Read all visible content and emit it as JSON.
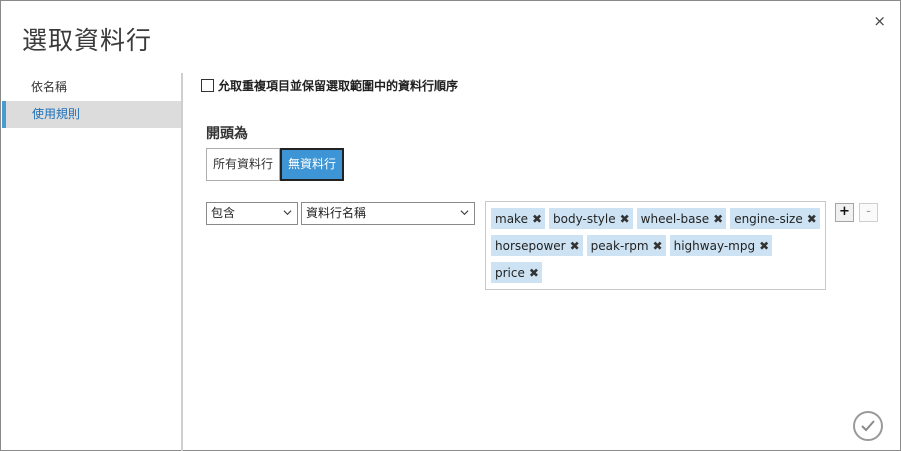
{
  "dialog": {
    "title": "選取資料行",
    "close_glyph": "×"
  },
  "sidebar": {
    "items": [
      {
        "label": "依名稱",
        "active": false
      },
      {
        "label": "使用規則",
        "active": true
      }
    ]
  },
  "options": {
    "allow_duplicates_label": "允取重複項目並保留選取範圍中的資料行順序",
    "allow_duplicates_checked": false
  },
  "begin_with": {
    "title": "開頭為",
    "buttons": [
      {
        "label": "所有資料行",
        "selected": false
      },
      {
        "label": "無資料行",
        "selected": true
      }
    ]
  },
  "rule": {
    "operator": "包含",
    "field": "資料行名稱",
    "tag_rows": [
      [
        "make",
        "body-style",
        "wheel-base",
        "engine-size"
      ],
      [
        "horsepower",
        "peak-rpm",
        "highway-mpg"
      ],
      [
        "price"
      ]
    ],
    "remove_glyph": "✖",
    "add_label": "+",
    "remove_label": "-"
  },
  "colors": {
    "accent": "#3e95d6",
    "tag_bg": "#cde3f3",
    "nav_active_text": "#1f70b8"
  },
  "icons": {
    "close": "close-icon",
    "chevron": "chevron-down-icon",
    "ok": "checkmark-icon"
  }
}
